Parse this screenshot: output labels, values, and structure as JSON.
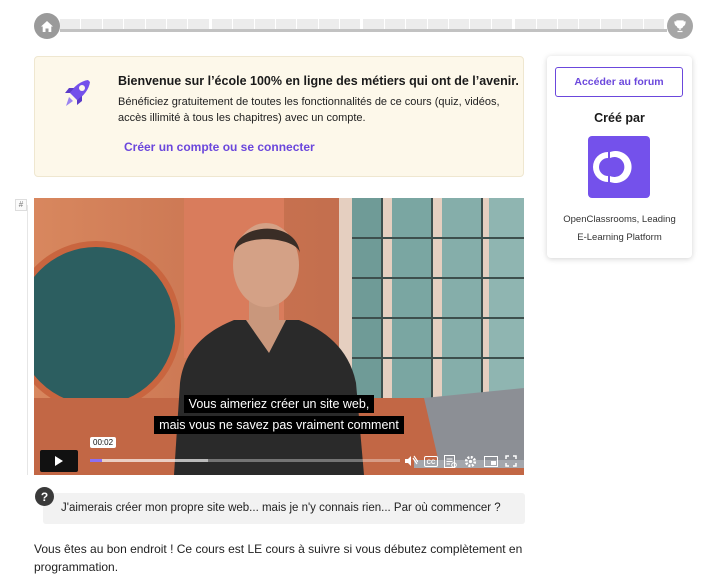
{
  "progress": {
    "home_icon": "home-icon",
    "trophy_icon": "trophy-icon",
    "segments": 28
  },
  "banner": {
    "title": "Bienvenue sur l’école 100% en ligne des métiers qui ont de l’avenir.",
    "text": "Bénéficiez gratuitement de toutes les fonctionnalités de ce cours (quiz, vidéos, accès illimité à tous les chapitres) avec un compte.",
    "link": "Créer un compte ou se connecter",
    "icon": "rocket-icon"
  },
  "sidebar": {
    "forum_button": "Accéder au forum",
    "created_by_title": "Créé par",
    "author_line1": "OpenClassrooms, Leading",
    "author_line2": "E-Learning Platform"
  },
  "anchor": "#",
  "video": {
    "caption_line1": "Vous aimeriez créer un site web,",
    "caption_line2": "mais vous ne savez pas vraiment comment",
    "time": "00:02",
    "progress_fraction": 0.04
  },
  "question": {
    "icon": "?",
    "text": "J'aimerais créer mon propre site web... mais je n'y connais rien... Par où commencer ?"
  },
  "paragraph": "Vous êtes au bon endroit ! Ce cours est LE cours à suivre si vous débutez complètement en programmation.",
  "colors": {
    "accent": "#6b47dc",
    "banner_bg": "#fdf8ea",
    "logo": "#7451eb"
  }
}
